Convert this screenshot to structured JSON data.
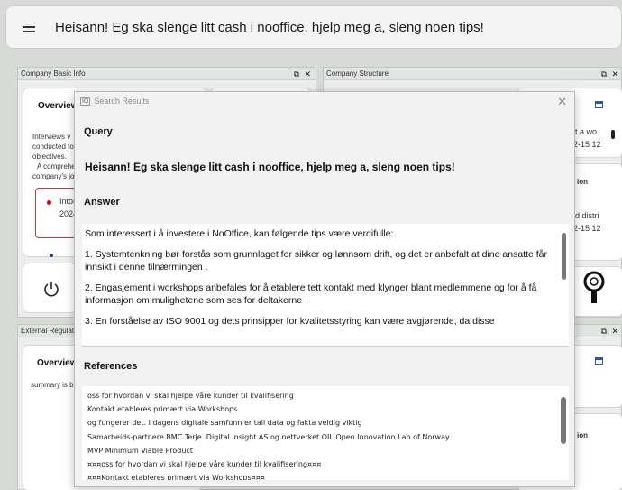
{
  "topbar": {
    "query": "Heisann! Eg ska slenge litt cash i nooffice, hjelp meg a, sleng noen tips!"
  },
  "panels": {
    "company_basic": {
      "title": "Company Basic Info",
      "overview": "Overview",
      "text_lines": [
        "Interviews v",
        "conducted to",
        "objectives.",
        "A comprehe",
        "company's jo"
      ],
      "event_title": "Intor",
      "event_date": "2024"
    },
    "company_structure": {
      "title": "Company Structure",
      "line1": "t a wo",
      "line2": "2-15 12",
      "label_ion": "ion",
      "line3": "d distri",
      "line4": "2-15 12"
    },
    "external": {
      "title": "External Regulat",
      "overview": "Overview",
      "summary": "summary is b",
      "label_ion": "ion"
    }
  },
  "modal": {
    "title": "Search Results",
    "query_label": "Query",
    "query_text": "Heisann! Eg ska slenge litt cash i nooffice, hjelp meg a, sleng noen tips!",
    "answer_label": "Answer",
    "answer": [
      "Som interessert i å investere i NoOffice, kan følgende tips være verdifulle:",
      "1. Systemtenkning bør forstås som grunnlaget for sikker og lønnsom drift, og det er anbefalt at dine ansatte får innsikt i denne tilnærmingen .",
      "2. Engasjement i workshops anbefales for å etablere tett kontakt med klynger blant medlemmene og for å få informasjon om mulighetene som ses for deltakerne .",
      "3. En forståelse av ISO 9001 og dets prinsipper for kvalitetsstyring kan være avgjørende, da disse"
    ],
    "references_label": "References",
    "references": [
      "oss for hvordan vi skal hjelpe våre kunder til kvalifisering",
      "Kontakt etableres primært via Workshops",
      "og fungerer det. I dagens digitale samfunn er tall data og fakta veldig viktig",
      "Samarbeids-partnere BMC Terje. Digital Insight AS og nettverket OIL Open Innovation Lab of Norway",
      "MVP Minimum Viable Product",
      "¤¤¤oss for hvordan vi skal hjelpe våre kunder til kvalifisering¤¤¤",
      "¤¤¤Kontakt etableres primært via Workshops¤¤¤"
    ]
  }
}
